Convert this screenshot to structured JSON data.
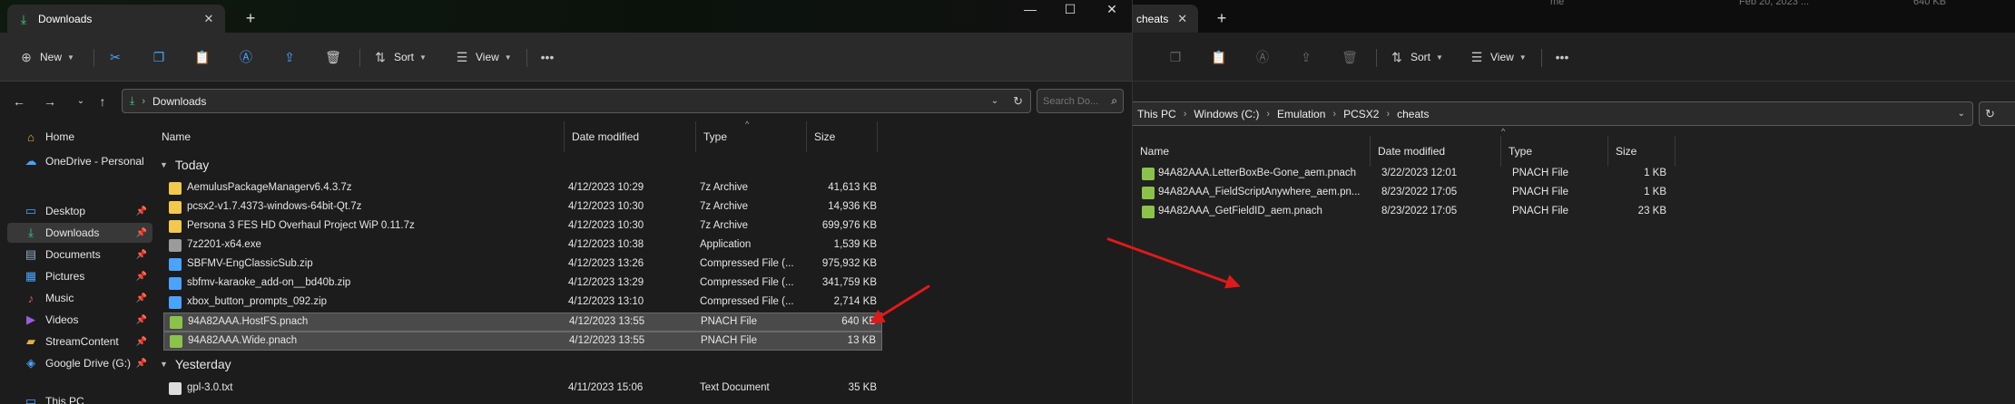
{
  "left_window": {
    "tab_title": "Downloads",
    "toolbar": {
      "new_label": "New",
      "sort_label": "Sort",
      "view_label": "View"
    },
    "address": {
      "crumb": "Downloads"
    },
    "search_placeholder": "Search Do...",
    "sidebar": [
      {
        "label": "Home",
        "icon": "home-icon"
      },
      {
        "label": "OneDrive - Personal",
        "icon": "cloud-icon"
      },
      {
        "label": "Desktop",
        "icon": "desktop-icon"
      },
      {
        "label": "Downloads",
        "icon": "download-icon"
      },
      {
        "label": "Documents",
        "icon": "documents-icon"
      },
      {
        "label": "Pictures",
        "icon": "pictures-icon"
      },
      {
        "label": "Music",
        "icon": "music-icon"
      },
      {
        "label": "Videos",
        "icon": "videos-icon"
      },
      {
        "label": "StreamContent",
        "icon": "folder-icon"
      },
      {
        "label": "Google Drive (G:)",
        "icon": "drive-icon"
      },
      {
        "label": "This PC",
        "icon": "pc-icon"
      }
    ],
    "columns": {
      "name": "Name",
      "date": "Date modified",
      "type": "Type",
      "size": "Size"
    },
    "groups": {
      "today": "Today",
      "yesterday": "Yesterday"
    },
    "files": [
      {
        "name": "AemulusPackageManagerv6.4.3.7z",
        "date": "4/12/2023 10:29",
        "type": "7z Archive",
        "size": "41,613 KB",
        "kind": "archive"
      },
      {
        "name": "pcsx2-v1.7.4373-windows-64bit-Qt.7z",
        "date": "4/12/2023 10:30",
        "type": "7z Archive",
        "size": "14,936 KB",
        "kind": "archive"
      },
      {
        "name": "Persona 3 FES HD Overhaul Project WiP 0.11.7z",
        "date": "4/12/2023 10:30",
        "type": "7z Archive",
        "size": "699,976 KB",
        "kind": "archive"
      },
      {
        "name": "7z2201-x64.exe",
        "date": "4/12/2023 10:38",
        "type": "Application",
        "size": "1,539 KB",
        "kind": "exe"
      },
      {
        "name": "SBFMV-EngClassicSub.zip",
        "date": "4/12/2023 13:26",
        "type": "Compressed File (...",
        "size": "975,932 KB",
        "kind": "zip"
      },
      {
        "name": "sbfmv-karaoke_add-on__bd40b.zip",
        "date": "4/12/2023 13:29",
        "type": "Compressed File (...",
        "size": "341,759 KB",
        "kind": "zip"
      },
      {
        "name": "xbox_button_prompts_092.zip",
        "date": "4/12/2023 13:10",
        "type": "Compressed File (...",
        "size": "2,714 KB",
        "kind": "zip"
      },
      {
        "name": "94A82AAA.HostFS.pnach",
        "date": "4/12/2023 13:55",
        "type": "PNACH File",
        "size": "640 KB",
        "kind": "pnach"
      },
      {
        "name": "94A82AAA.Wide.pnach",
        "date": "4/12/2023 13:55",
        "type": "PNACH File",
        "size": "13 KB",
        "kind": "pnach"
      }
    ],
    "yesterday_files": [
      {
        "name": "gpl-3.0.txt",
        "date": "4/11/2023 15:06",
        "type": "Text Document",
        "size": "35 KB",
        "kind": "txt"
      }
    ]
  },
  "right_window": {
    "tab_title": "cheats",
    "toolbar": {
      "sort_label": "Sort",
      "view_label": "View"
    },
    "breadcrumbs": [
      "This PC",
      "Windows (C:)",
      "Emulation",
      "PCSX2",
      "cheats"
    ],
    "top_strip": [
      "me",
      "Feb 20, 2023 ...",
      "640 KB"
    ],
    "columns": {
      "name": "Name",
      "date": "Date modified",
      "type": "Type",
      "size": "Size"
    },
    "files": [
      {
        "name": "94A82AAA.LetterBoxBe-Gone_aem.pnach",
        "date": "3/22/2023 12:01",
        "type": "PNACH File",
        "size": "1 KB"
      },
      {
        "name": "94A82AAA_FieldScriptAnywhere_aem.pn...",
        "date": "8/23/2022 17:05",
        "type": "PNACH File",
        "size": "1 KB"
      },
      {
        "name": "94A82AAA_GetFieldID_aem.pnach",
        "date": "8/23/2022 17:05",
        "type": "PNACH File",
        "size": "23 KB"
      }
    ]
  },
  "colors": {
    "accent": "#3fd07a",
    "arrow": "#e0191a",
    "selection": "#4a4a4a"
  }
}
